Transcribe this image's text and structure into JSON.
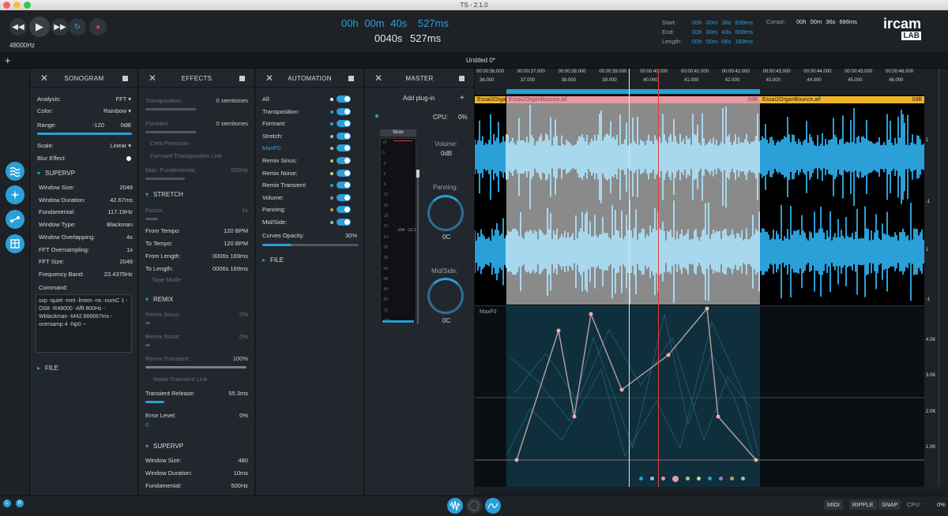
{
  "window_title": "TS - 2.1.0",
  "transport": {
    "sample_rate": "48000Hz",
    "time_primary": [
      "00h",
      "00m",
      "40s",
      "527ms"
    ],
    "time_secondary": [
      "0040s",
      "527ms"
    ],
    "start_label": "Start:",
    "start_value": [
      "00h",
      "00m",
      "36s",
      "839ms"
    ],
    "end_label": "End:",
    "end_value": [
      "00h",
      "00m",
      "43s",
      "008ms"
    ],
    "length_label": "Length:",
    "length_value": [
      "00h",
      "00m",
      "06s",
      "169ms"
    ],
    "cursor_label": "Cursor:",
    "cursor_value": [
      "00h",
      "00m",
      "36s",
      "686ms"
    ],
    "logo_top": "ircam",
    "logo_bottom": "LAB"
  },
  "tabbar": {
    "add": "+",
    "tab_title": "Untitled 0*"
  },
  "sonogram": {
    "title": "SONOGRAM",
    "analysis_label": "Analysis:",
    "analysis_value": "FFT",
    "color_label": "Color:",
    "color_value": "Rainbow",
    "range_label": "Range:",
    "range_min": "-120",
    "range_max": "0dB",
    "scale_label": "Scale:",
    "scale_value": "Linear",
    "blur_label": "Blur Effect:",
    "supervp_title": "SUPERVP",
    "params": [
      {
        "label": "Window Size:",
        "value": "2048"
      },
      {
        "label": "Window Duration:",
        "value": "42.67ms"
      },
      {
        "label": "Fundamental:",
        "value": "117.19Hz"
      },
      {
        "label": "Window Type:",
        "value": "Blackman"
      },
      {
        "label": "Window Overlapping:",
        "value": "4x"
      },
      {
        "label": "FFT Oversampling:",
        "value": "1x"
      },
      {
        "label": "FFT Size:",
        "value": "2048"
      },
      {
        "label": "Frequency Band:",
        "value": "23.4375Hz"
      }
    ],
    "command_label": "Command:",
    "command_text": "svp -quiet -nmt -lmem -ns -numC 1 -OS8 -R48000 -Afft 800Hz -Wblackman -M42.666667ms -oversamp 4 -Np0 --",
    "file_title": "FILE"
  },
  "effects": {
    "title": "EFFECTS",
    "transposition_label": "Transposition:",
    "transposition_value": "0 semitones",
    "formant_label": "Formant:",
    "formant_value": "0 semitones",
    "cent_precision": "Cent Precision",
    "formant_link": "Formant-Transposition Link",
    "max_fund_label": "Max. Fundamental:",
    "max_fund_value": "800Hz",
    "stretch_title": "STRETCH",
    "factor_label": "Factor:",
    "factor_value": "1x",
    "from_tempo_label": "From Tempo:",
    "from_tempo_value": "120 BPM",
    "to_tempo_label": "To Tempo:",
    "to_tempo_value": "120 BPM",
    "from_length_label": "From Length:",
    "from_length_value": "0006s  169ms",
    "to_length_label": "To Length:",
    "to_length_value": "0006s  169ms",
    "tape_mode": "Tape Mode",
    "remix_title": "REMIX",
    "remix_sinus_label": "Remix Sinus:",
    "remix_sinus_value": "0%",
    "remix_noise_label": "Remix Noise:",
    "remix_noise_value": "0%",
    "remix_transient_label": "Remix Transient:",
    "remix_transient_value": "100%",
    "noise_transient_link": "Noise-Transient Link",
    "transient_release_label": "Transient Release:",
    "transient_release_value": "55.3ms",
    "error_level_label": "Error Level:",
    "error_level_value": "0%",
    "error_level_sub": "0",
    "supervp_title": "SUPERVP",
    "window_size_label": "Window Size:",
    "window_size_value": "480",
    "window_duration_label": "Window Duration:",
    "window_duration_value": "10ms",
    "fundamental_label": "Fundamental:",
    "fundamental_value": "500Hz"
  },
  "automation": {
    "title": "AUTOMATION",
    "items": [
      {
        "label": "All:",
        "dot": "#ffffff",
        "active": false
      },
      {
        "label": "Transposition:",
        "dot": "#2a9fd8",
        "active": false
      },
      {
        "label": "Formant:",
        "dot": "#2a9fd8",
        "active": false
      },
      {
        "label": "Stretch:",
        "dot": "#7ec8e3",
        "active": false
      },
      {
        "label": "MaxF0:",
        "dot": "#d9a0a0",
        "active": true
      },
      {
        "label": "Remix Sinus:",
        "dot": "#9ad17a",
        "active": false
      },
      {
        "label": "Remix Noise:",
        "dot": "#d1d17a",
        "active": false
      },
      {
        "label": "Remix Transient:",
        "dot": "#2a9fd8",
        "active": false
      },
      {
        "label": "Volume:",
        "dot": "#a07ad1",
        "active": false
      },
      {
        "label": "Panning:",
        "dot": "#d19a4a",
        "active": false
      },
      {
        "label": "Mid/Side:",
        "dot": "#7ad19a",
        "active": false
      }
    ],
    "curves_opacity_label": "Curves Opacity:",
    "curves_opacity_value": "30%",
    "file_title": "FILE"
  },
  "master": {
    "title": "MASTER",
    "add_plugin": "Add plug-in",
    "add_icon": "+",
    "cpu_label": "CPU:",
    "cpu_value": "0%",
    "mute": "Mute",
    "meter_scale_left": [
      "+6",
      "0",
      "-3",
      "-6",
      "-9",
      "-12",
      "-15",
      "-18",
      "-21",
      "-24",
      "-30",
      "-36",
      "-42",
      "-48",
      "-54",
      "-60",
      "-72",
      "-120"
    ],
    "meter_values": [
      "-104",
      "-10.1"
    ],
    "volume_label": "Volume:",
    "volume_value": "0dB",
    "panning_label": "Panning:",
    "panning_value": "0C",
    "midside_label": "Mid/Side:",
    "midside_value": "0C"
  },
  "editor": {
    "ruler_ticks": [
      "00:00:36.000",
      "00:00:37.000",
      "00:00:38.000",
      "00:00:39.000",
      "00:00:40.000",
      "00:00:41.000",
      "00:00:42.000",
      "00:00:43.000",
      "00:00:44.000",
      "00:00:45.000",
      "00:00:46.000"
    ],
    "ruler_sub": [
      "36.000",
      "37.000",
      "38.000",
      "39.000",
      "40.000",
      "41.000",
      "42.000",
      "43.000",
      "44.000",
      "45.000",
      "46.000"
    ],
    "clips": [
      {
        "name": "Essai2Orga",
        "gain": ""
      },
      {
        "name": "Essai2OrganBounce.aif",
        "gain": "0dB"
      },
      {
        "name": "Essai2OrganBounce.aif",
        "gain": "0dB"
      }
    ],
    "automation_lane_label": "MaxF0",
    "freq_scale": [
      "4.0K",
      "3.0K",
      "2.0K",
      "1.0K"
    ],
    "amp_scale": [
      "1",
      "-1",
      "1",
      "-1"
    ]
  },
  "bottom": {
    "left_btn": "L",
    "right_btn": "R",
    "midi": "MIDI",
    "ripple": "RIPPLE",
    "snap": "SNAP",
    "cpu_label": "CPU:",
    "cpu_value": "0%"
  },
  "colors": {
    "accent": "#2a9fd8",
    "clip_pink": "#e89aa2",
    "clip_yellow": "#f0b429",
    "selection": "#8a8a8a"
  }
}
